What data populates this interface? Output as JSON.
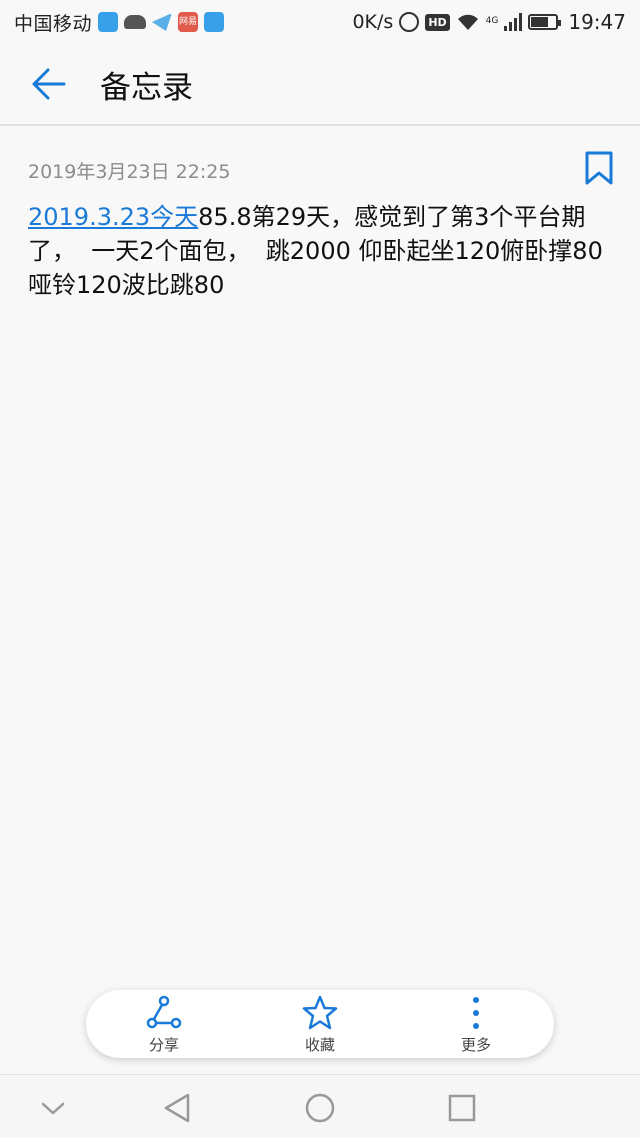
{
  "status_bar": {
    "carrier": "中国移动",
    "news_badge": "网易",
    "net_speed": "0K/s",
    "hd": "HD",
    "network_type": "4G",
    "time": "19:47",
    "battery_level": 0.7
  },
  "app_bar": {
    "back_icon": "arrow-left-icon",
    "title": "备忘录",
    "accent": "#1a7ad8"
  },
  "note": {
    "date": "2019年3月23日 22:25",
    "bookmark_icon": "bookmark-icon",
    "link_text": "2019.3.23今天",
    "body_text": "85.8第29天，感觉到了第3个平台期了，  一天2个面包，  跳2000 仰卧起坐120俯卧撑80哑铃120波比跳80"
  },
  "actions": [
    {
      "label": "分享",
      "icon": "share-icon"
    },
    {
      "label": "收藏",
      "icon": "star-icon"
    },
    {
      "label": "更多",
      "icon": "more-vertical-icon"
    }
  ],
  "nav": {
    "icons": [
      "chevron-down-icon",
      "back-triangle-icon",
      "home-circle-icon",
      "recents-square-icon"
    ]
  }
}
